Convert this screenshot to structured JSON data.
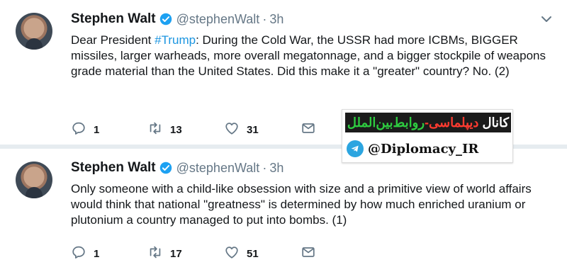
{
  "tweets": [
    {
      "author": "Stephen Walt",
      "handle": "@stephenWalt",
      "separator": "·",
      "time": "3h",
      "text_before": "Dear President ",
      "hashtag": "#Trump",
      "text_after": ": During the Cold War, the USSR had more ICBMs, BIGGER missiles, larger warheads, more overall megatonnage, and a bigger stockpile of weapons grade material than the United States.  Did this make it a \"greater\" country?  No. (2)",
      "replies": "1",
      "retweets": "13",
      "likes": "31"
    },
    {
      "author": "Stephen Walt",
      "handle": "@stephenWalt",
      "separator": "·",
      "time": "3h",
      "text": "Only someone with a child-like obsession with size and a primitive view of world affairs would think that national \"greatness\" is determined by how much enriched uranium or plutonium a country managed to put into bombs. (1)",
      "replies": "1",
      "retweets": "17",
      "likes": "51"
    }
  ],
  "watermark": {
    "channel_prefix": "کانال",
    "channel_red": "دیپلماسی-",
    "channel_green": "روابط‌بین‌الملل",
    "handle": "@Diplomacy_IR"
  },
  "colors": {
    "link": "#1b95e0",
    "muted": "#657786",
    "verified": "#1da1f2",
    "icon": "#657786"
  },
  "icons": [
    "verified-badge-icon",
    "chevron-down-icon",
    "reply-icon",
    "retweet-icon",
    "like-icon",
    "message-icon",
    "telegram-icon"
  ]
}
